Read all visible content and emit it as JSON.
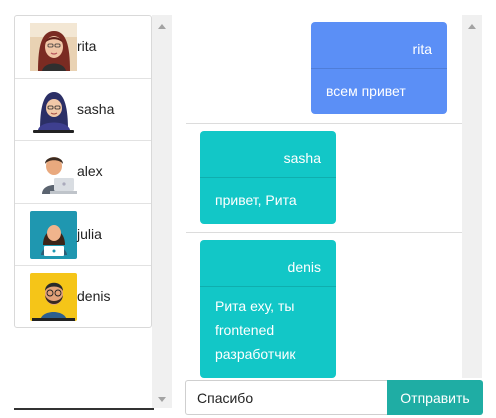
{
  "users": [
    {
      "name": "rita",
      "avatar": "photo-avatar"
    },
    {
      "name": "sasha",
      "avatar": "hijab-woman-avatar"
    },
    {
      "name": "alex",
      "avatar": "man-laptop-avatar"
    },
    {
      "name": "julia",
      "avatar": "woman-laptop-avatar"
    },
    {
      "name": "denis",
      "avatar": "bearded-man-avatar"
    }
  ],
  "messages": [
    {
      "author": "rita",
      "text": "всем привет",
      "color": "#5b8ff6",
      "own": true
    },
    {
      "author": "sasha",
      "text": "привет, Рита",
      "color": "#12c7c7",
      "own": false
    },
    {
      "author": "denis",
      "text": "Рита еху, ты frontened разработчик",
      "color": "#12c7c7",
      "own": false
    }
  ],
  "composer": {
    "input_value": "Спасибо",
    "send_label": "Отправить",
    "button_color": "#1fada4"
  }
}
